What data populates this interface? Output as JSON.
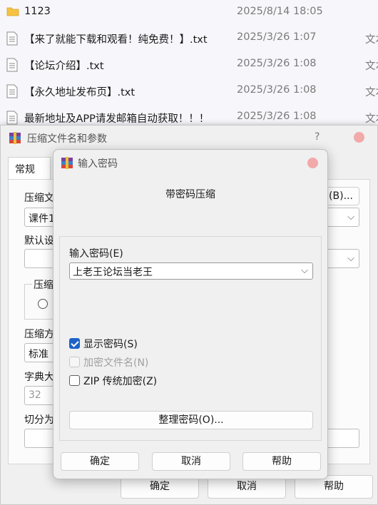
{
  "files": [
    {
      "name": "1123",
      "date": "2025/8/14 18:05",
      "type": "",
      "icon": "folder-icon"
    },
    {
      "name": "【来了就能下载和观看！纯免费！】.txt",
      "date": "2025/3/26 1:07",
      "type": "文本",
      "icon": "text-file-icon"
    },
    {
      "name": "【论坛介绍】.txt",
      "date": "2025/3/26 1:08",
      "type": "文本",
      "icon": "text-file-icon"
    },
    {
      "name": "【永久地址发布页】.txt",
      "date": "2025/3/26 1:08",
      "type": "文本",
      "icon": "text-file-icon"
    },
    {
      "name": "最新地址及APP请发邮箱自动获取！！！",
      "date": "2025/3/26 1:08",
      "type": "文本",
      "icon": "text-file-icon"
    }
  ],
  "archive_dialog": {
    "title": "压缩文件名和参数",
    "help_glyph": "?",
    "tab_general": "常规",
    "archive_name_label": "压缩文",
    "archive_name_value": "课件1",
    "browse_button": "(B)...",
    "default_profile_label": "默认设",
    "format_group_label": "压缩",
    "method_label": "压缩方",
    "method_value": "标准",
    "dict_label": "字典大",
    "dict_value": "32",
    "split_label": "切分为",
    "ok_button": "确定",
    "cancel_button": "取消",
    "help_button": "帮助"
  },
  "password_dialog": {
    "title": "输入密码",
    "heading": "带密码压缩",
    "password_label": "输入密码(E)",
    "password_value": "上老王论坛当老王",
    "show_password": {
      "label": "显示密码(S)",
      "checked": true
    },
    "encrypt_filenames": {
      "label": "加密文件名(N)",
      "checked": false,
      "disabled": true
    },
    "zip_legacy": {
      "label": "ZIP 传统加密(Z)",
      "checked": false
    },
    "organize_button": "整理密码(O)...",
    "ok_button": "确定",
    "cancel_button": "取消",
    "help_button": "帮助"
  },
  "colors": {
    "accent": "#1e63c7",
    "close": "#f1a9a9",
    "folder": "#f5c242"
  }
}
